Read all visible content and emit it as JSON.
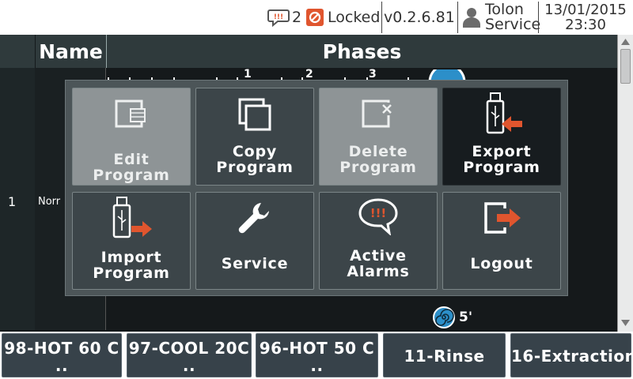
{
  "status_bar": {
    "alarm_icon": "alarm-bubble-icon",
    "alarm_count": "2",
    "lock_icon": "lock-forbidden-icon",
    "lock_status": "Locked",
    "version": "v0.2.6.81",
    "user_icon": "user-icon",
    "user_line1": "Tolon",
    "user_line2": "Service",
    "date": "13/01/2015",
    "time": "23:30"
  },
  "table": {
    "col_name": "Name",
    "col_phases": "Phases",
    "row_number": "1",
    "row_name_partial": "Norr",
    "phase_tick_labels": [
      "1",
      "2",
      "3"
    ],
    "spin_duration": "5'"
  },
  "menu": {
    "tiles": [
      {
        "label_1": "Edit Program",
        "label_2": "",
        "icon": "edit-program-icon",
        "state": "disabled"
      },
      {
        "label_1": "Copy",
        "label_2": "Program",
        "icon": "copy-program-icon",
        "state": "normal"
      },
      {
        "label_1": "Delete",
        "label_2": "Program",
        "icon": "delete-program-icon",
        "state": "disabled"
      },
      {
        "label_1": "Export",
        "label_2": "Program",
        "icon": "usb-export-icon",
        "state": "active"
      },
      {
        "label_1": "Import",
        "label_2": "Program",
        "icon": "usb-import-icon",
        "state": "normal"
      },
      {
        "label_1": "Service",
        "label_2": "",
        "icon": "wrench-icon",
        "state": "normal"
      },
      {
        "label_1": "Active",
        "label_2": "Alarms",
        "icon": "alarm-bubble-icon",
        "state": "normal"
      },
      {
        "label_1": "Logout",
        "label_2": "",
        "icon": "logout-icon",
        "state": "normal"
      }
    ]
  },
  "program_buttons": [
    {
      "line1": "98-HOT 60 C",
      "line2": ".."
    },
    {
      "line1": "97-COOL 20C",
      "line2": ".."
    },
    {
      "line1": "96-HOT 50 C",
      "line2": ".."
    },
    {
      "line1": "11-Rinse",
      "line2": ""
    },
    {
      "line1": "16-Extraction",
      "line2": ""
    }
  ],
  "colors": {
    "accent_orange": "#e0552e",
    "tile_normal": "#3c4549",
    "tile_disabled": "#8e9496",
    "tile_active": "#171c1f",
    "button_bg": "#37424a"
  }
}
